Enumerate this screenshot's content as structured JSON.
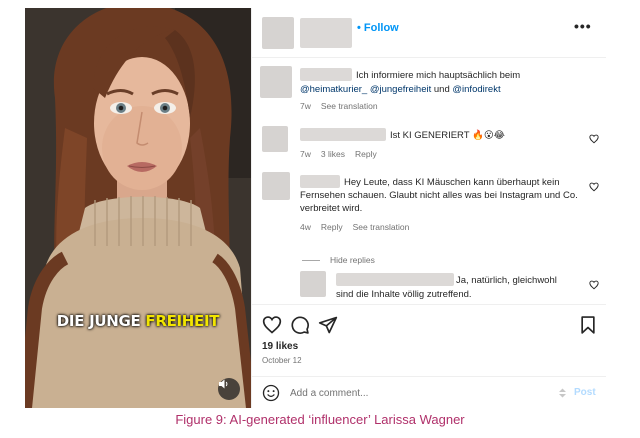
{
  "header": {
    "follow_label": "• Follow",
    "more_label": "•••"
  },
  "video": {
    "caption_word1": "DIE JUNGE ",
    "caption_word2": "FREIHEIT",
    "caption_word2_color": "#f2e500"
  },
  "comments": [
    {
      "text_pre": "Ich informiere mich hauptsächlich beim",
      "mention1": "@heimatkurier_",
      "mention2": "@jungefreiheit",
      "text_und": " und ",
      "mention3": "@infodirekt",
      "time": "7w",
      "translate": "See translation"
    },
    {
      "text": "Ist KI GENERIERT 🔥😮😂",
      "time": "7w",
      "likes": "3 likes",
      "reply": "Reply"
    },
    {
      "text": "Hey Leute, dass KI Mäuschen kann überhaupt kein Fernsehen schauen. Glaubt nicht alles was bei Instagram und Co. verbreitet wird.",
      "time": "4w",
      "reply": "Reply",
      "translate": "See translation",
      "hide_replies": "Hide replies"
    },
    {
      "text_line1": "Ja, natürlich, gleichwohl",
      "text_line2": "sind die Inhalte völlig zutreffend."
    }
  ],
  "post": {
    "likes": "19 likes",
    "date": "October 12"
  },
  "comment_box": {
    "placeholder": "Add a comment...",
    "post_label": "Post"
  },
  "figure_caption": "Figure 9: AI-generated ‘influencer’ Larissa Wagner",
  "colors": {
    "link": "#0095f6",
    "mention": "#00376b",
    "caption": "#b0306a"
  }
}
